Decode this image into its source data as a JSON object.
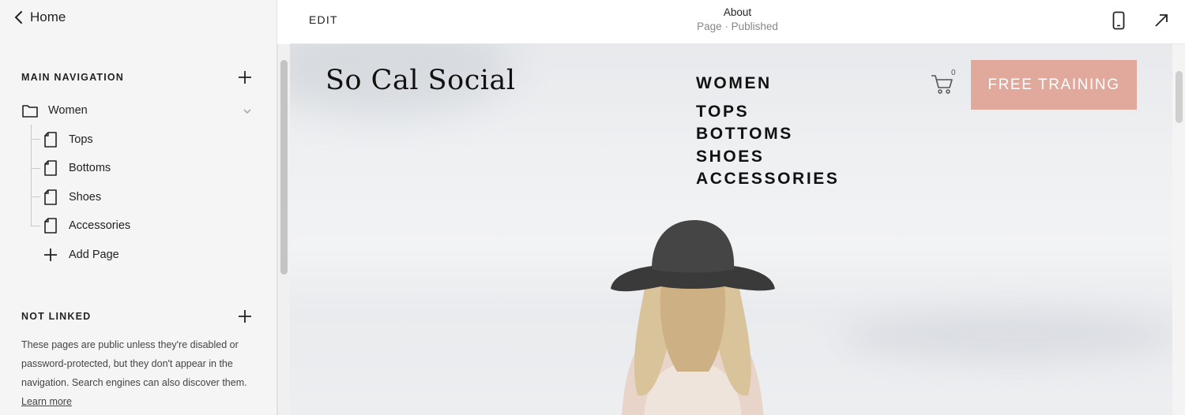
{
  "sidebar": {
    "back_label": "Home",
    "main_nav": {
      "title": "MAIN NAVIGATION",
      "folder": {
        "label": "Women",
        "icon": "folder-icon"
      },
      "children": [
        {
          "label": "Tops",
          "icon": "page-icon"
        },
        {
          "label": "Bottoms",
          "icon": "page-icon"
        },
        {
          "label": "Shoes",
          "icon": "page-icon"
        },
        {
          "label": "Accessories",
          "icon": "page-icon"
        }
      ],
      "add_page_label": "Add Page"
    },
    "not_linked": {
      "title": "NOT LINKED",
      "description": "These pages are public unless they're disabled or password-protected, but they don't appear in the navigation. Search engines can also discover them.",
      "learn_more": "Learn more"
    }
  },
  "topbar": {
    "edit_label": "EDIT",
    "page_title": "About",
    "page_status": "Page · Published",
    "icons": [
      "mobile-preview-icon",
      "expand-icon"
    ]
  },
  "preview": {
    "site_title": "So Cal Social",
    "nav_main": "WOMEN",
    "nav_sub": [
      "TOPS",
      "BOTTOMS",
      "SHOES",
      "ACCESSORIES"
    ],
    "cart_count": "0",
    "cta_label": "FREE TRAINING",
    "colors": {
      "cta": "#e1a89c",
      "sky": "#eef0f2"
    }
  }
}
